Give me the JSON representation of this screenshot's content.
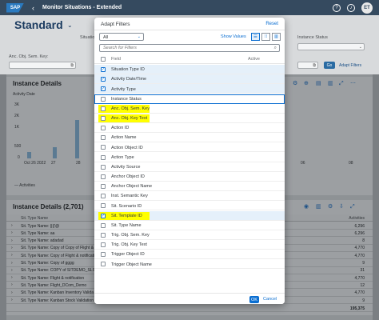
{
  "shell": {
    "logo": "SAP",
    "title": "Monitor Situations - Extended",
    "help_icon": "?",
    "user_initials": "ET"
  },
  "filterbar": {
    "variant": "Standard",
    "labels": [
      "Situation",
      "Instance Status",
      "Anc. Obj. Sem. Key:"
    ],
    "go": "Go",
    "adapt_filters": "Adapt Filters"
  },
  "chart_card": {
    "title": "Instance Details",
    "ylabel": "Activity Date",
    "y_ticks": [
      "3K",
      "2K",
      "1K",
      "500",
      "0"
    ],
    "x_ticks": [
      "Oct 26\n2022",
      "27",
      "28",
      "06",
      "08"
    ],
    "legend": "Activities"
  },
  "table": {
    "title": "Instance Details (2,701)",
    "col_name": "Sit. Type Name",
    "col_activities": "Activities",
    "rows": [
      {
        "name": "Sit. Type Name: ||||'@",
        "value": "6,296"
      },
      {
        "name": "Sit. Type Name: aa",
        "value": "6,296"
      },
      {
        "name": "Sit. Type Name: adadad",
        "value": "8"
      },
      {
        "name": "Sit. Type Name: Copy of Copy of Flight &",
        "value": "4,770"
      },
      {
        "name": "Sit. Type Name: Copy of Flight & notificati",
        "value": "4,770"
      },
      {
        "name": "Sit. Type Name: Copy of gggg",
        "value": "9"
      },
      {
        "name": "Sit. Type Name: COPY of SITDEMO_SLS",
        "value": "31"
      },
      {
        "name": "Sit. Type Name: Flight & notification",
        "value": "4,770"
      },
      {
        "name": "Sit. Type Name: Flight_DCom_Demo",
        "value": "12"
      },
      {
        "name": "Sit. Type Name: Kanban Inventory Valida",
        "value": "4,770"
      },
      {
        "name": "Sit. Type Name: Kanban Stock Validation",
        "value": "9"
      }
    ],
    "total": "195,375"
  },
  "dialog": {
    "title": "Adapt Filters",
    "reset": "Reset",
    "scope": "All",
    "show_values": "Show Values",
    "search_placeholder": "Search for Filters",
    "col_field": "Field",
    "col_active": "Active",
    "ok": "OK",
    "cancel": "Cancel",
    "fields": [
      {
        "label": "Situation Type ID",
        "checked": true
      },
      {
        "label": "Activity Date/Time",
        "checked": true
      },
      {
        "label": "Activity Type",
        "checked": true
      },
      {
        "label": "Instance Status",
        "checked": false,
        "focused": true
      },
      {
        "label": "Anc. Obj. Sem. Key",
        "checked": false,
        "highlight": true
      },
      {
        "label": "Anc. Obj. Key Text",
        "checked": false,
        "highlight": true
      },
      {
        "label": "Action ID",
        "checked": false
      },
      {
        "label": "Action Name",
        "checked": false
      },
      {
        "label": "Action Object ID",
        "checked": false
      },
      {
        "label": "Action Type",
        "checked": false
      },
      {
        "label": "Activity Source",
        "checked": false
      },
      {
        "label": "Anchor Object ID",
        "checked": false
      },
      {
        "label": "Anchor Object Name",
        "checked": false
      },
      {
        "label": "Inst. Semantic Key",
        "checked": false
      },
      {
        "label": "Sit. Scenario ID",
        "checked": false
      },
      {
        "label": "Sit. Template ID",
        "checked": true,
        "highlight": true
      },
      {
        "label": "Sit. Type Name",
        "checked": false
      },
      {
        "label": "Trig. Obj. Sem. Key",
        "checked": false
      },
      {
        "label": "Trig. Obj. Key Text",
        "checked": false
      },
      {
        "label": "Trigger Object ID",
        "checked": false
      },
      {
        "label": "Trigger Object Name",
        "checked": false
      }
    ]
  },
  "colors": {
    "shell": "#354a5f",
    "accent": "#0a6ed1",
    "highlight": "#ffff00",
    "selected_row": "#e5f0fa"
  }
}
